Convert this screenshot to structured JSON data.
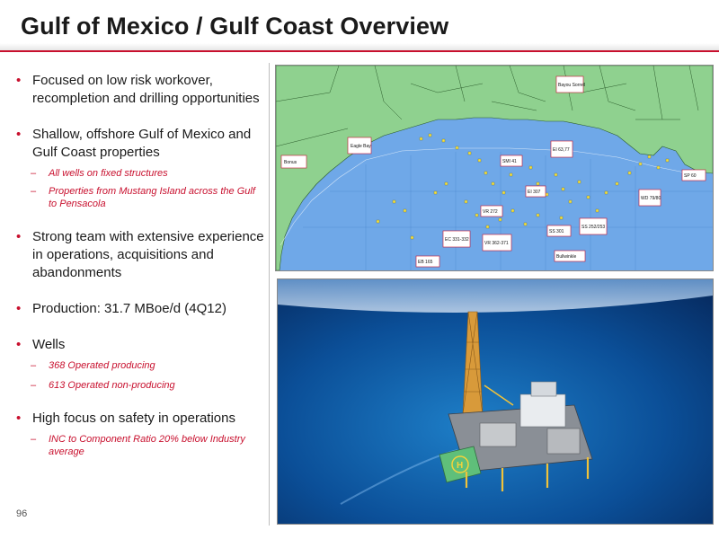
{
  "header": {
    "title": "Gulf of Mexico / Gulf Coast Overview"
  },
  "bullets": [
    {
      "text": "Focused on low risk workover, recompletion and drilling opportunities",
      "subs": []
    },
    {
      "text": "Shallow, offshore Gulf of Mexico and Gulf Coast properties",
      "subs": [
        "All wells on fixed structures",
        "Properties from Mustang Island across the Gulf to Pensacola"
      ]
    },
    {
      "text": "Strong team with extensive experience in operations, acquisitions and abandonments",
      "subs": []
    },
    {
      "text": "Production: 31.7 MBoe/d (4Q12)",
      "subs": []
    },
    {
      "text": "Wells",
      "subs": [
        "368 Operated producing",
        "613 Operated non-producing"
      ]
    },
    {
      "text": "High focus on safety in operations",
      "subs": [
        "INC to Component Ratio 20% below Industry average"
      ]
    }
  ],
  "map": {
    "labels": {
      "bonus": "Bonus",
      "eagle_bay": "Eagle Bay",
      "bayou_sorrell": "Bayou Sorrell",
      "ei_6377": "EI 63,77",
      "smi41": "SMI 41",
      "ei307": "EI 307",
      "vr272": "VR 272",
      "ec": "EC 331-332",
      "vr": "VR 362-371",
      "ss301": "SS 301",
      "ss252": "SS 252/253",
      "bullwinkle": "Bullwinkle",
      "wd": "WD 79/80",
      "sp60": "SP 60",
      "eb165": "EB 165"
    }
  },
  "page_number": "96",
  "colors": {
    "accent": "#c8102e",
    "land": "#8fd18f",
    "water": "#6fa8e8"
  }
}
